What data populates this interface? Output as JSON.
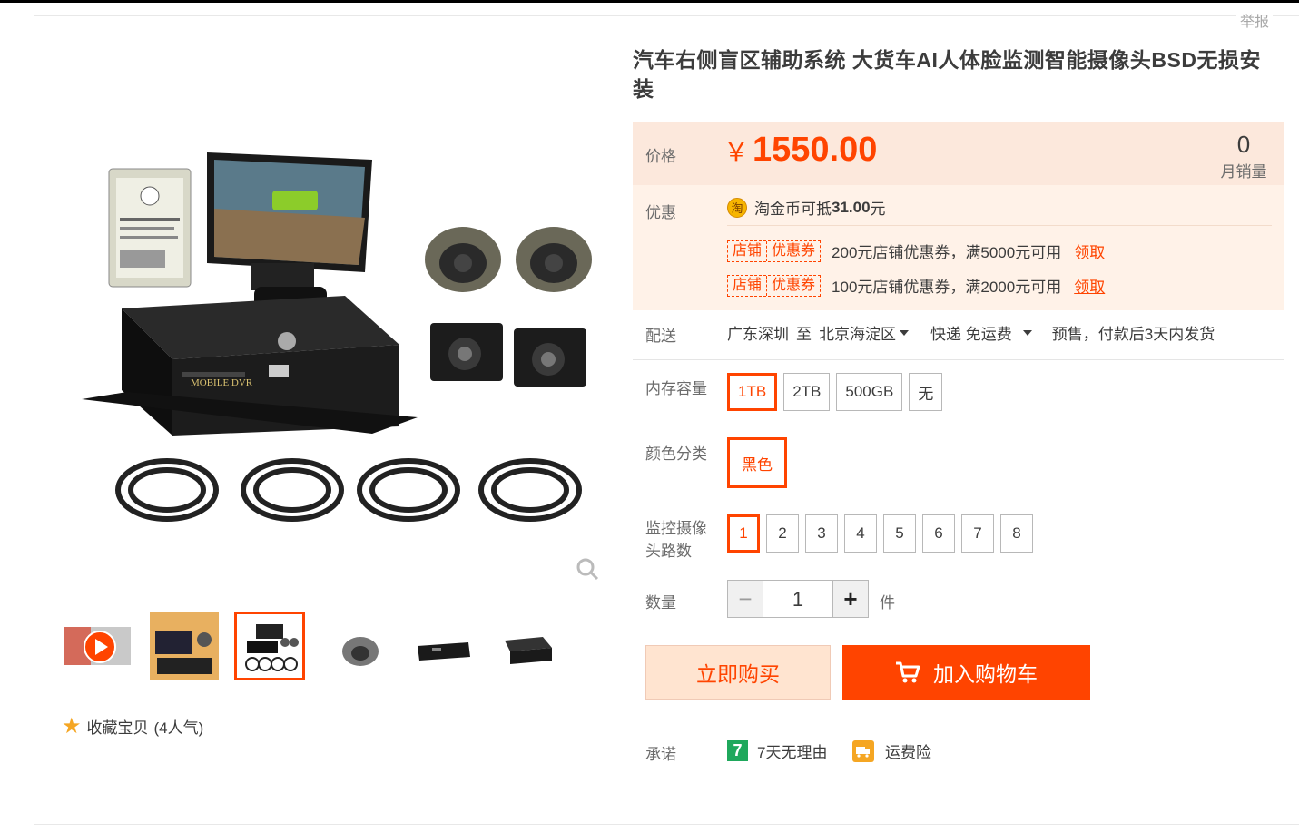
{
  "report_link": "举报",
  "product": {
    "title": "汽车右侧盲区辅助系统 大货车AI人体脸监测智能摄像头BSD无损安装"
  },
  "price": {
    "label": "价格",
    "currency": "￥",
    "value": "1550.00",
    "sales_count": "0",
    "sales_label": "月销量"
  },
  "promo": {
    "label": "优惠",
    "coin_icon": "淘",
    "coin_text": "淘金币可抵",
    "coin_amount": "31.00",
    "coin_unit": "元",
    "coupons": [
      {
        "tag_a": "店铺",
        "tag_b": "优惠券",
        "text": "200元店铺优惠券，满5000元可用",
        "claim": "领取"
      },
      {
        "tag_a": "店铺",
        "tag_b": "优惠券",
        "text": "100元店铺优惠券，满2000元可用",
        "claim": "领取"
      }
    ]
  },
  "shipping": {
    "label": "配送",
    "from": "广东深圳",
    "to_word": "至",
    "to": "北京海淀区",
    "method": "快递 免运费",
    "note": "预售，付款后3天内发货"
  },
  "options": {
    "storage": {
      "label": "内存容量",
      "items": [
        "1TB",
        "2TB",
        "500GB",
        "无"
      ],
      "selected": "1TB"
    },
    "color": {
      "label": "颜色分类",
      "items": [
        "黑色"
      ],
      "selected": "黑色"
    },
    "channels": {
      "label_line1": "监控摄像",
      "label_line2": "头路数",
      "items": [
        "1",
        "2",
        "3",
        "4",
        "5",
        "6",
        "7",
        "8"
      ],
      "selected": "1"
    }
  },
  "quantity": {
    "label": "数量",
    "minus": "−",
    "value": "1",
    "plus": "+",
    "unit": "件"
  },
  "actions": {
    "buy_now": "立即购买",
    "add_to_cart": "加入购物车"
  },
  "promise": {
    "label": "承诺",
    "items": [
      {
        "icon": "7",
        "text": "7天无理由"
      },
      {
        "icon": "freight-insurance-icon",
        "text": "运费险"
      }
    ]
  },
  "favorite": {
    "text": "收藏宝贝",
    "popularity": "(4人气)"
  },
  "colors": {
    "accent": "#ff4400",
    "price_bg": "#fff2e8",
    "buy_bg": "#ffe4d0"
  }
}
